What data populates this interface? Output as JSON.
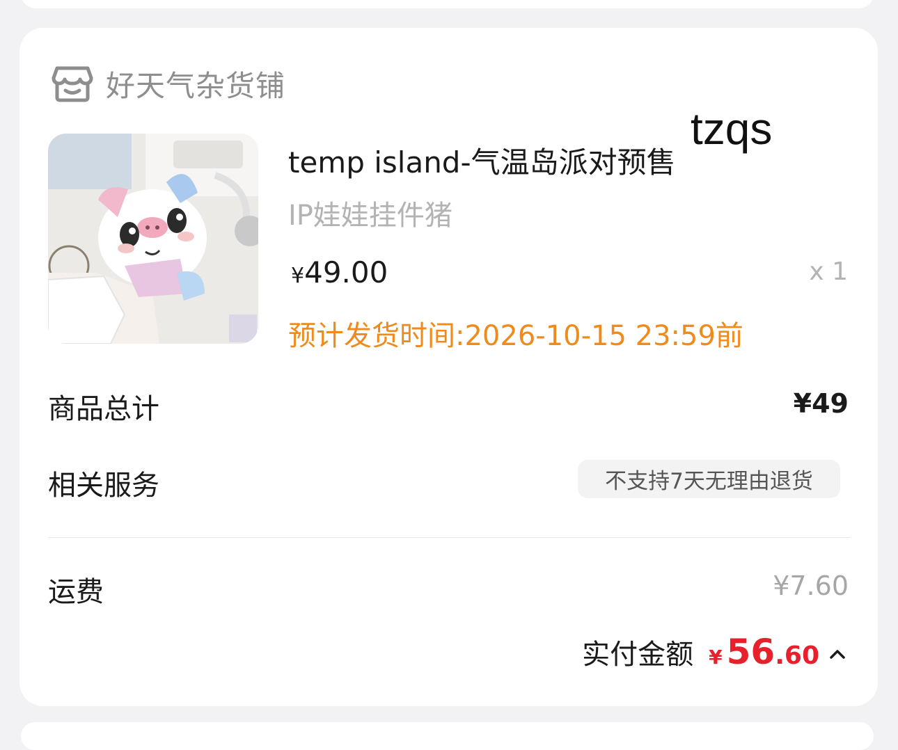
{
  "store": {
    "name": "好天气杂货铺",
    "icon": "store-icon"
  },
  "product": {
    "title": "temp island-气温岛派对预售",
    "subtitle": "IP娃娃挂件猪",
    "price_currency": "¥",
    "price": "49.00",
    "quantity": "x 1",
    "ship_time": "预计发货时间:2026-10-15 23:59前",
    "image": "pig-plush-keychain-photo"
  },
  "summary": {
    "total_label": "商品总计",
    "total_value": "¥49",
    "service_label": "相关服务",
    "service_tag": "不支持7天无理由退货",
    "freight_label": "运费",
    "freight_value": "¥7.60",
    "paid_label": "实付金额",
    "paid_currency": "¥",
    "paid_int": "56",
    "paid_dec": ".60"
  },
  "watermark": "tzqs",
  "colors": {
    "accent_orange": "#ef8a1c",
    "price_red": "#e8202b",
    "muted": "#b3b3b3"
  }
}
